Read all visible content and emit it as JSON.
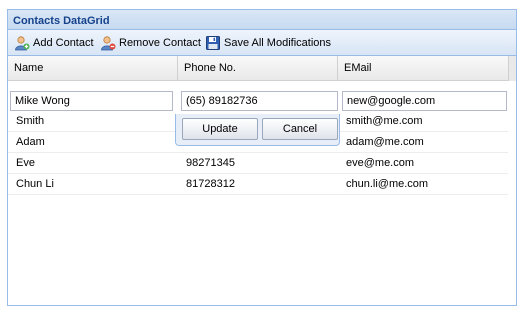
{
  "panel": {
    "title": "Contacts DataGrid"
  },
  "toolbar": {
    "add_label": "Add Contact",
    "remove_label": "Remove Contact",
    "save_label": "Save All Modifications"
  },
  "columns": [
    "Name",
    "Phone No.",
    "EMail"
  ],
  "editor": {
    "name": "Mike Wong",
    "phone": "(65) 89182736",
    "email": "new@google.com",
    "update_label": "Update",
    "cancel_label": "Cancel"
  },
  "rows": [
    {
      "name": "Smith",
      "phone": "",
      "email": "smith@me.com"
    },
    {
      "name": "Adam",
      "phone": "",
      "email": "adam@me.com"
    },
    {
      "name": "Eve",
      "phone": "98271345",
      "email": "eve@me.com"
    },
    {
      "name": "Chun Li",
      "phone": "81728312",
      "email": "chun.li@me.com"
    }
  ],
  "colors": {
    "title": "#15428b",
    "border": "#99bbe8"
  },
  "icons": {
    "add": "add-user-icon",
    "remove": "remove-user-icon",
    "save": "floppy-disk-icon"
  }
}
